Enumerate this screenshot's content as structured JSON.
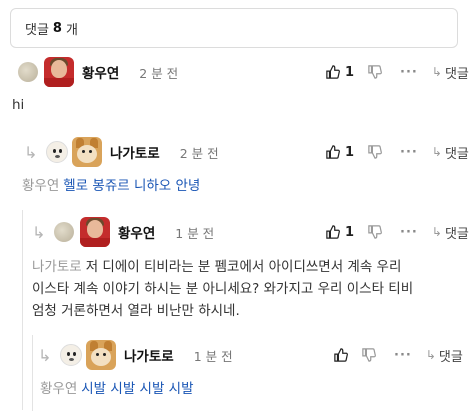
{
  "comment_count": {
    "prefix": "댓글",
    "count": "8",
    "suffix": "개"
  },
  "comments": [
    {
      "author": "황우연",
      "time": "2 분 전",
      "likes": "1",
      "reply_label": "댓글",
      "mention": "",
      "text": "hi"
    },
    {
      "author": "나가토로",
      "time": "2 분 전",
      "likes": "1",
      "reply_label": "댓글",
      "mention": "황우연",
      "text": "헬로 봉쥬르 니하오 안녕"
    },
    {
      "author": "황우연",
      "time": "1 분 전",
      "likes": "1",
      "reply_label": "댓글",
      "mention": "나가토로",
      "text_lines": [
        "저 디에이 티비라는 분 펨코에서 아이디쓰면서 계속 우리",
        "이스타 계속 이야기 하시는 분 아니세요? 와가지고 우리 이스타 티비",
        "엄청 거론하면서 열라 비난만 하시네."
      ]
    },
    {
      "author": "나가토로",
      "time": "1 분 전",
      "likes": "",
      "reply_label": "댓글",
      "mention": "황우연",
      "text": "시발 시발 시발 시발"
    }
  ],
  "icons": {
    "like": "thumbs-up-icon",
    "dislike": "thumbs-down-icon",
    "more": "more-dots-icon",
    "reply": "reply-arrow-icon"
  }
}
